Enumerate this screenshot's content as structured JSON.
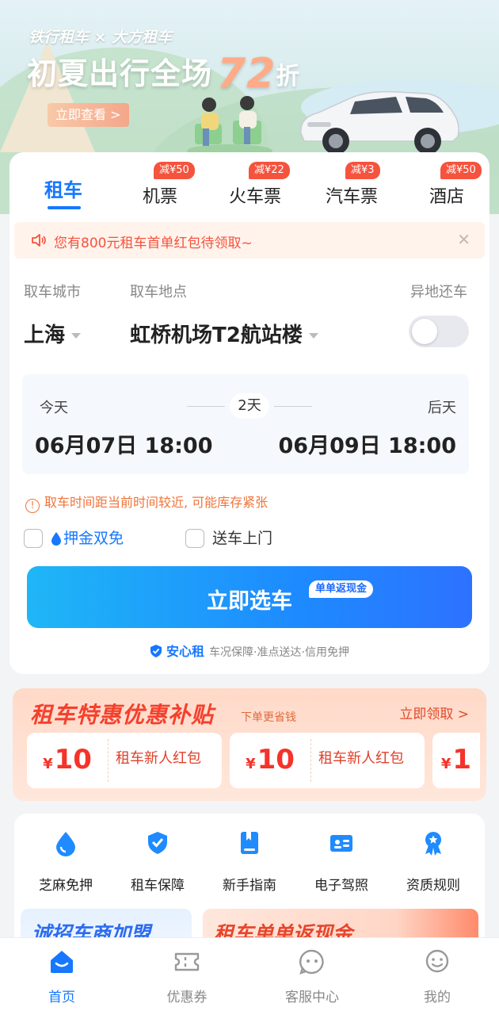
{
  "banner": {
    "brand": "铁行租车 × 大方租车",
    "headline_text": "初夏出行全场",
    "headline_number": "72",
    "headline_unit": "折",
    "cta": "立即查看 >"
  },
  "tabs": [
    {
      "label": "租车",
      "active": true,
      "badge": ""
    },
    {
      "label": "机票",
      "active": false,
      "badge": "减¥50"
    },
    {
      "label": "火车票",
      "active": false,
      "badge": "减¥22"
    },
    {
      "label": "汽车票",
      "active": false,
      "badge": "减¥3"
    },
    {
      "label": "酒店",
      "active": false,
      "badge": "减¥50"
    }
  ],
  "notice": {
    "text": "您有800元租车首单红包待领取~"
  },
  "form": {
    "city_label": "取车城市",
    "city_value": "上海",
    "location_label": "取车地点",
    "location_value": "虹桥机场T2航站楼",
    "return_label": "异地还车",
    "return_toggle_on": false
  },
  "dates": {
    "pickup_day": "今天",
    "pickup_time": "06月07日 18:00",
    "duration": "2天",
    "return_day": "后天",
    "return_time": "06月09日 18:00"
  },
  "warning": "取车时间距当前时间较近, 可能库存紧张",
  "options": [
    {
      "label": "押金双免",
      "checked": false
    },
    {
      "label": "送车上门",
      "checked": false
    }
  ],
  "main_button": {
    "label": "立即选车",
    "tag": "单单返现金"
  },
  "assurance": {
    "name": "安心租",
    "desc": "车况保障·准点送达·信用免押"
  },
  "promo": {
    "title": "租车特惠优惠补贴",
    "subtitle": "下单更省钱",
    "more": "立即领取 >",
    "coupons": [
      {
        "currency": "¥",
        "amount": "10",
        "name": "租车新人红包"
      },
      {
        "currency": "¥",
        "amount": "10",
        "name": "租车新人红包"
      },
      {
        "currency": "¥",
        "amount": "1",
        "name": ""
      }
    ]
  },
  "quick_links": [
    {
      "label": "芝麻免押",
      "icon": "drop-icon"
    },
    {
      "label": "租车保障",
      "icon": "shield-check-icon"
    },
    {
      "label": "新手指南",
      "icon": "book-icon"
    },
    {
      "label": "电子驾照",
      "icon": "license-card-icon"
    },
    {
      "label": "资质规则",
      "icon": "award-icon"
    }
  ],
  "tiles": [
    {
      "text": "诚招车商加盟"
    },
    {
      "text": "租车单单返现金"
    }
  ],
  "bottom_nav": [
    {
      "label": "首页",
      "icon": "home-icon",
      "active": true
    },
    {
      "label": "优惠券",
      "icon": "ticket-icon",
      "active": false
    },
    {
      "label": "客服中心",
      "icon": "service-icon",
      "active": false
    },
    {
      "label": "我的",
      "icon": "profile-icon",
      "active": false
    }
  ],
  "colors": {
    "primary": "#1677ff",
    "badge": "#f5533d",
    "promo_red": "#f5402c",
    "warn": "#f0743a"
  }
}
